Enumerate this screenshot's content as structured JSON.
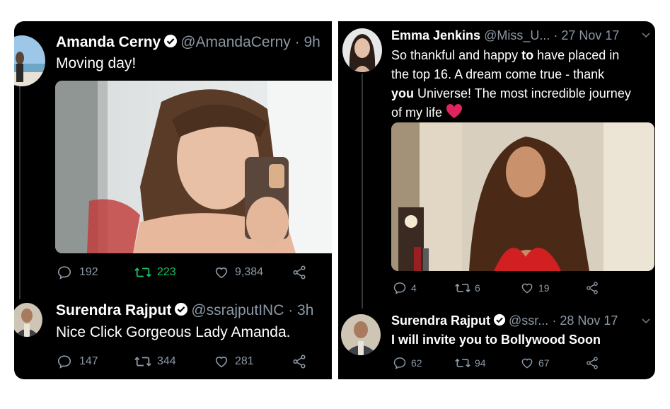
{
  "left": {
    "tweet1": {
      "name": "Amanda Cerny",
      "handle": "@AmandaCerny",
      "time": "· 9h",
      "text": "Moving day!",
      "replies": "192",
      "retweets": "223",
      "likes": "9,384"
    },
    "tweet2": {
      "name": "Surendra Rajput",
      "handle": "@ssrajputINC",
      "time": "· 3h",
      "text": "Nice Click Gorgeous Lady Amanda.",
      "replies": "147",
      "retweets": "344",
      "likes": "281"
    }
  },
  "right": {
    "tweet1": {
      "name": "Emma Jenkins",
      "handle": "@Miss_U...",
      "time": "· 27 Nov 17",
      "text_line1_a": "So thankful and happy ",
      "text_line1_b": "to",
      "text_line1_c": " have placed in",
      "text_line2": "the top 16. A dream come true - thank",
      "text_line3_a": "you",
      "text_line3_b": " Universe! The most incredible journey",
      "text_line4": "of my life",
      "replies": "4",
      "retweets": "6",
      "likes": "19"
    },
    "tweet2": {
      "name": "Surendra Rajput",
      "handle": "@ssr...",
      "time": "· 28 Nov 17",
      "text": "I will invite you to Bollywood Soon",
      "replies": "62",
      "retweets": "94",
      "likes": "67"
    }
  },
  "colors": {
    "background": "#000000",
    "muted": "#8b98a5",
    "retweet_active": "#17bf63",
    "verified": "#ffffff",
    "heart": "#e0245e"
  }
}
